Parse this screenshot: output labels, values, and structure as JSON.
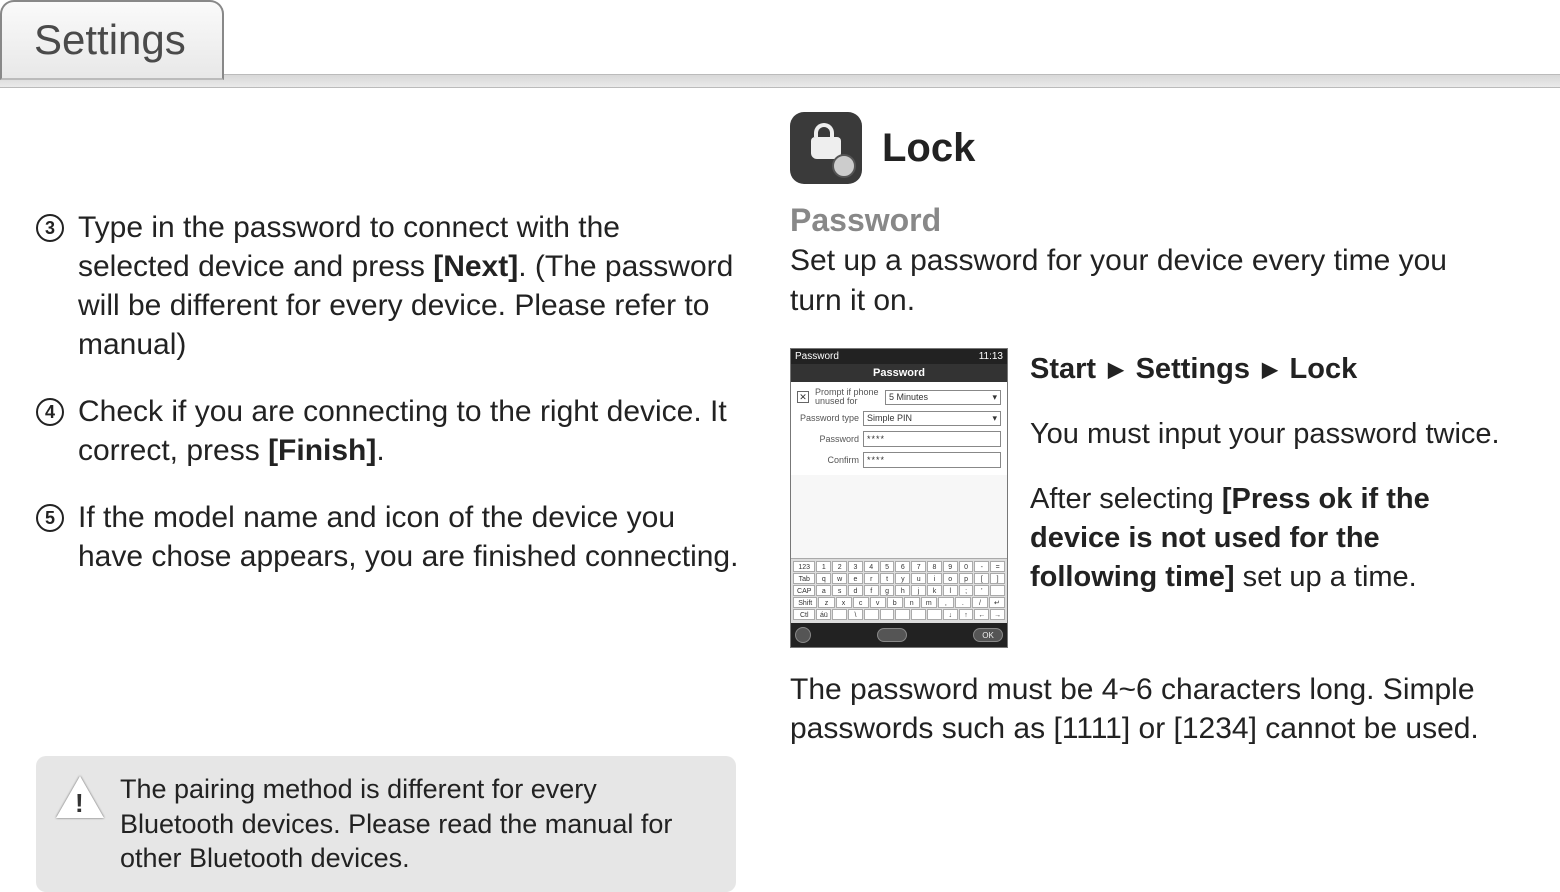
{
  "tab_label": "Settings",
  "left": {
    "steps": [
      {
        "num": "3",
        "pre": "Type in the password to connect with the selected device and press ",
        "bold": "[Next]",
        "post": ". (The password will be different for every device. Please refer to manual)"
      },
      {
        "num": "4",
        "pre": "Check if you are connecting to the right device. It correct, press ",
        "bold": "[Finish]",
        "post": "."
      },
      {
        "num": "5",
        "pre": "If the model name and icon of the device you have chose appears, you are finished connecting.",
        "bold": "",
        "post": ""
      }
    ],
    "note": "The pairing method is different for every Bluetooth devices. Please read the manual for other Bluetooth devices."
  },
  "right": {
    "lock_heading": "Lock",
    "password_label": "Password",
    "password_desc": "Set up a password for your device every time you turn it on.",
    "path": {
      "a": "Start",
      "b": "Settings",
      "c": "Lock"
    },
    "instr1": "You must input your password twice.",
    "instr2_pre": "After selecting ",
    "instr2_bold": "[Press ok if the device is not used for the following time]",
    "instr2_post": " set up a time.",
    "footer": "The password must be 4~6 characters long. Simple passwords such as [1111] or [1234] cannot be used."
  },
  "screenshot": {
    "titlebar_left": "Password",
    "titlebar_right": "11:13",
    "header": "Password",
    "check_label": "Prompt if phone unused for",
    "check_value": "5 Minutes",
    "type_label": "Password type",
    "type_value": "Simple PIN",
    "pw_label": "Password",
    "pw_value": "****",
    "confirm_label": "Confirm",
    "confirm_value": "****",
    "kb_rows": [
      [
        "123",
        "1",
        "2",
        "3",
        "4",
        "5",
        "6",
        "7",
        "8",
        "9",
        "0",
        "-",
        "="
      ],
      [
        "Tab",
        "q",
        "w",
        "e",
        "r",
        "t",
        "y",
        "u",
        "i",
        "o",
        "p",
        "[",
        "]"
      ],
      [
        "CAP",
        "a",
        "s",
        "d",
        "f",
        "g",
        "h",
        "j",
        "k",
        "l",
        ";",
        "'",
        " "
      ],
      [
        "Shift",
        "z",
        "x",
        "c",
        "v",
        "b",
        "n",
        "m",
        ",",
        ".",
        "/",
        "↵"
      ],
      [
        "Ctl",
        "áü",
        " ",
        "\\",
        " ",
        " ",
        " ",
        " ",
        " ",
        "↓",
        "↑",
        "←",
        "→"
      ]
    ],
    "ok_label": "OK"
  }
}
